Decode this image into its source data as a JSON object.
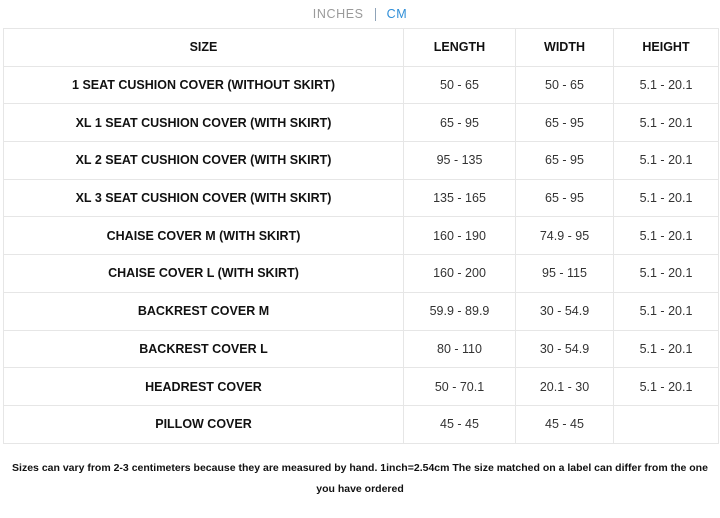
{
  "unit_toggle": {
    "inches_label": "INCHES",
    "cm_label": "CM",
    "selected": "CM",
    "active_color": "#2f8fd8",
    "inactive_color": "#9a9a9a"
  },
  "table": {
    "headers": [
      "SIZE",
      "LENGTH",
      "WIDTH",
      "HEIGHT"
    ],
    "rows": [
      {
        "size": "1 SEAT CUSHION COVER (WITHOUT SKIRT)",
        "length": "50 - 65",
        "width": "50 - 65",
        "height": "5.1 - 20.1"
      },
      {
        "size": "XL 1 SEAT CUSHION COVER (WITH SKIRT)",
        "length": "65 - 95",
        "width": "65 - 95",
        "height": "5.1 - 20.1"
      },
      {
        "size": "XL 2 SEAT CUSHION COVER (WITH SKIRT)",
        "length": "95 - 135",
        "width": "65 - 95",
        "height": "5.1 - 20.1"
      },
      {
        "size": "XL 3 SEAT CUSHION COVER (WITH SKIRT)",
        "length": "135 - 165",
        "width": "65 - 95",
        "height": "5.1 - 20.1"
      },
      {
        "size": "CHAISE COVER M (WITH SKIRT)",
        "length": "160 - 190",
        "width": "74.9 - 95",
        "height": "5.1 - 20.1"
      },
      {
        "size": "CHAISE COVER L (WITH SKIRT)",
        "length": "160 - 200",
        "width": "95 - 115",
        "height": "5.1 - 20.1"
      },
      {
        "size": "BACKREST COVER M",
        "length": "59.9 - 89.9",
        "width": "30 - 54.9",
        "height": "5.1 - 20.1"
      },
      {
        "size": "BACKREST COVER L",
        "length": "80 - 110",
        "width": "30 - 54.9",
        "height": "5.1 - 20.1"
      },
      {
        "size": "HEADREST COVER",
        "length": "50 - 70.1",
        "width": "20.1 - 30",
        "height": "5.1 - 20.1"
      },
      {
        "size": "PILLOW COVER",
        "length": "45 - 45",
        "width": "45 - 45",
        "height": ""
      }
    ]
  },
  "footnote": "Sizes can vary from 2-3 centimeters because they are measured by hand. 1inch=2.54cm The size matched on a label can differ from the one you have ordered"
}
